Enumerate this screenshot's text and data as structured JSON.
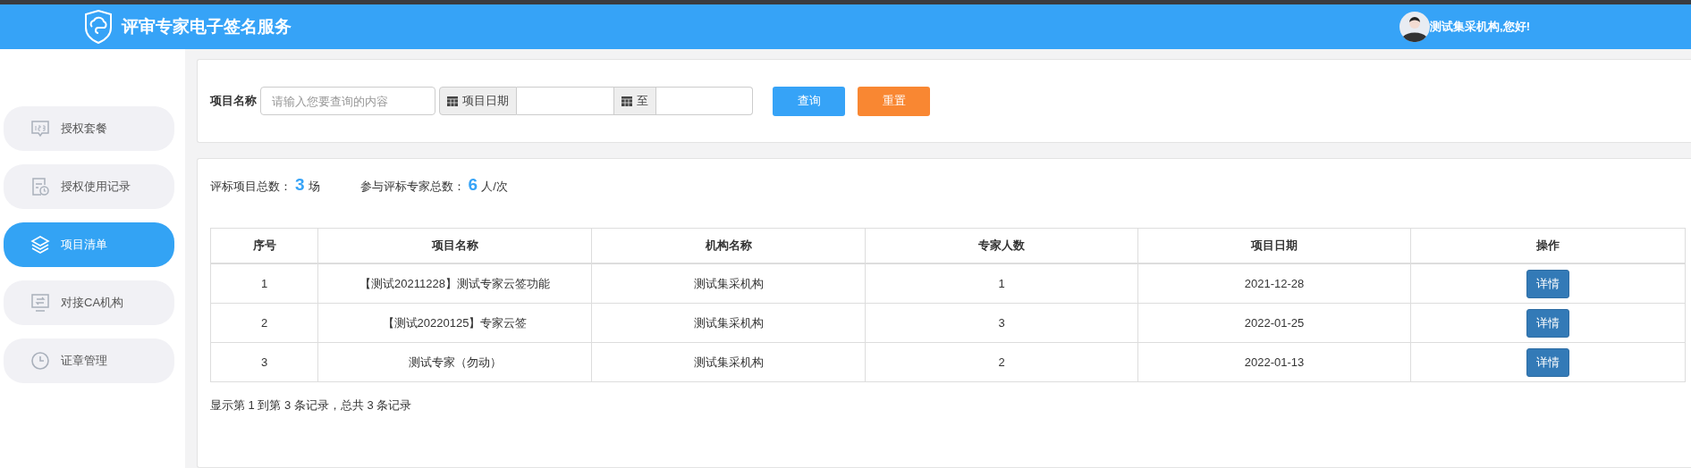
{
  "header": {
    "title": "评审专家电子签名服务",
    "greeting": "测试集采机构,您好!"
  },
  "sidebar": {
    "items": [
      {
        "label": "授权套餐",
        "selected": false
      },
      {
        "label": "授权使用记录",
        "selected": false
      },
      {
        "label": "项目清单",
        "selected": true
      },
      {
        "label": "对接CA机构",
        "selected": false
      },
      {
        "label": "证章管理",
        "selected": false
      }
    ]
  },
  "filter": {
    "name_label": "项目名称",
    "name_placeholder": "请输入您要查询的内容",
    "date_label": "项目日期",
    "to_label": "至",
    "search_button": "查询",
    "reset_button": "重置"
  },
  "stats": [
    {
      "label": "评标项目总数：",
      "value": "3",
      "unit": "场"
    },
    {
      "label": "参与评标专家总数：",
      "value": "6",
      "unit": "人/次"
    }
  ],
  "table": {
    "columns": [
      "序号",
      "项目名称",
      "机构名称",
      "专家人数",
      "项目日期",
      "操作"
    ],
    "rows": [
      {
        "cells": [
          "1",
          "【测试20211228】测试专家云签功能",
          "测试集采机构",
          "1",
          "2021-12-28"
        ],
        "action": "详情"
      },
      {
        "cells": [
          "2",
          "【测试20220125】专家云签",
          "测试集采机构",
          "3",
          "2022-01-25"
        ],
        "action": "详情"
      },
      {
        "cells": [
          "3",
          "测试专家（勿动）",
          "测试集采机构",
          "2",
          "2022-01-13"
        ],
        "action": "详情"
      }
    ]
  },
  "pagination": "显示第 1 到第 3 条记录，总共 3 条记录"
}
